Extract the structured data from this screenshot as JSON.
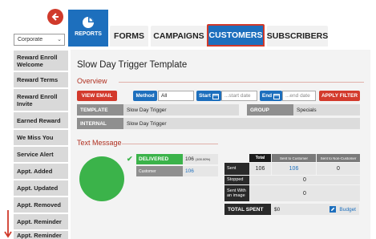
{
  "account": {
    "selected": "Corporate"
  },
  "nav": {
    "reports_label": "REPORTS",
    "tabs": [
      {
        "label": "FORMS"
      },
      {
        "label": "CAMPAIGNS"
      },
      {
        "label": "CUSTOMERS",
        "active": true
      },
      {
        "label": "SUBSCRIBERS"
      }
    ]
  },
  "sidebar": {
    "items": [
      {
        "label": "Reward Enroll Welcome"
      },
      {
        "label": "Reward Terms"
      },
      {
        "label": "Reward Enroll Invite"
      },
      {
        "label": "Earned Reward"
      },
      {
        "label": "We Miss You"
      },
      {
        "label": "Service Alert"
      },
      {
        "label": "Appt. Added"
      },
      {
        "label": "Appt. Updated"
      },
      {
        "label": "Appt. Removed"
      },
      {
        "label": "Appt. Reminder"
      },
      {
        "label": "Appt. Reminder"
      }
    ]
  },
  "main": {
    "title": "Slow Day Trigger Template",
    "overview_title": "Overview",
    "filters": {
      "view_email": "VIEW EMAIL",
      "method_label": "Method",
      "method_value": "All",
      "start_label": "Start",
      "start_placeholder": "...start date",
      "end_label": "End",
      "end_placeholder": "...end date",
      "apply": "APPLY FILTER"
    },
    "template_label": "TEMPLATE",
    "template_value": "Slow Day Trigger",
    "group_label": "GROUP",
    "group_value": "Specials",
    "internal_label": "INTERNAL",
    "internal_value": "Slow Day Trigger",
    "text_message_title": "Text Message",
    "delivered_label": "DELIVERED",
    "delivered_value": "106",
    "delivered_pct": "(100.00%)",
    "customer_label": "Customer",
    "customer_value": "106",
    "donut_fraction": 1.0,
    "table": {
      "headers": [
        "Total",
        "Sent to Customer",
        "Sent to Non-Customer"
      ],
      "rows": [
        {
          "label": "Sent",
          "total": "106",
          "customer": "106",
          "noncustomer": "0"
        },
        {
          "label": "Stopped",
          "merged": "0"
        },
        {
          "label": "Sent With an image",
          "merged": "0"
        }
      ]
    },
    "total_spent_label": "TOTAL SPENT",
    "total_spent_value": "$0",
    "budget_label": "Budget"
  },
  "colors": {
    "brand_blue": "#1d6fbd",
    "accent_red": "#d33a2c",
    "success_green": "#3bb34a"
  }
}
